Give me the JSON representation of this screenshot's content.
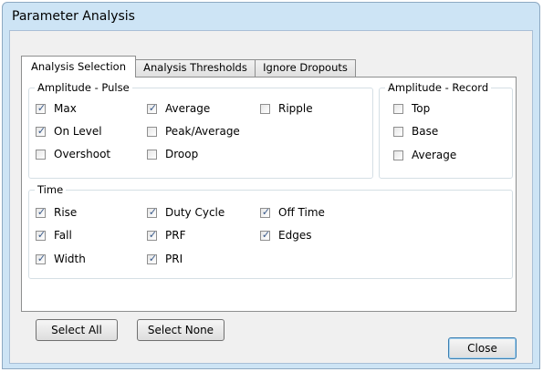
{
  "window": {
    "title": "Parameter Analysis"
  },
  "tabs": [
    {
      "label": "Analysis Selection",
      "active": true
    },
    {
      "label": "Analysis Thresholds",
      "active": false
    },
    {
      "label": "Ignore Dropouts",
      "active": false
    }
  ],
  "groups": {
    "amplitude_pulse": {
      "label": "Amplitude - Pulse",
      "items": [
        {
          "label": "Max",
          "checked": true
        },
        {
          "label": "On Level",
          "checked": true
        },
        {
          "label": "Overshoot",
          "checked": false
        },
        {
          "label": "Average",
          "checked": true
        },
        {
          "label": "Peak/Average",
          "checked": false
        },
        {
          "label": "Droop",
          "checked": false
        },
        {
          "label": "Ripple",
          "checked": false
        }
      ]
    },
    "amplitude_record": {
      "label": "Amplitude - Record",
      "items": [
        {
          "label": "Top",
          "checked": false
        },
        {
          "label": "Base",
          "checked": false
        },
        {
          "label": "Average",
          "checked": false
        }
      ]
    },
    "time": {
      "label": "Time",
      "items": [
        {
          "label": "Rise",
          "checked": true
        },
        {
          "label": "Fall",
          "checked": true
        },
        {
          "label": "Width",
          "checked": true
        },
        {
          "label": "Duty Cycle",
          "checked": true
        },
        {
          "label": "PRF",
          "checked": true
        },
        {
          "label": "PRI",
          "checked": true
        },
        {
          "label": "Off Time",
          "checked": true
        },
        {
          "label": "Edges",
          "checked": true
        }
      ]
    }
  },
  "buttons": {
    "select_all": "Select All",
    "select_none": "Select None",
    "close": "Close"
  },
  "checkmark": "✓"
}
